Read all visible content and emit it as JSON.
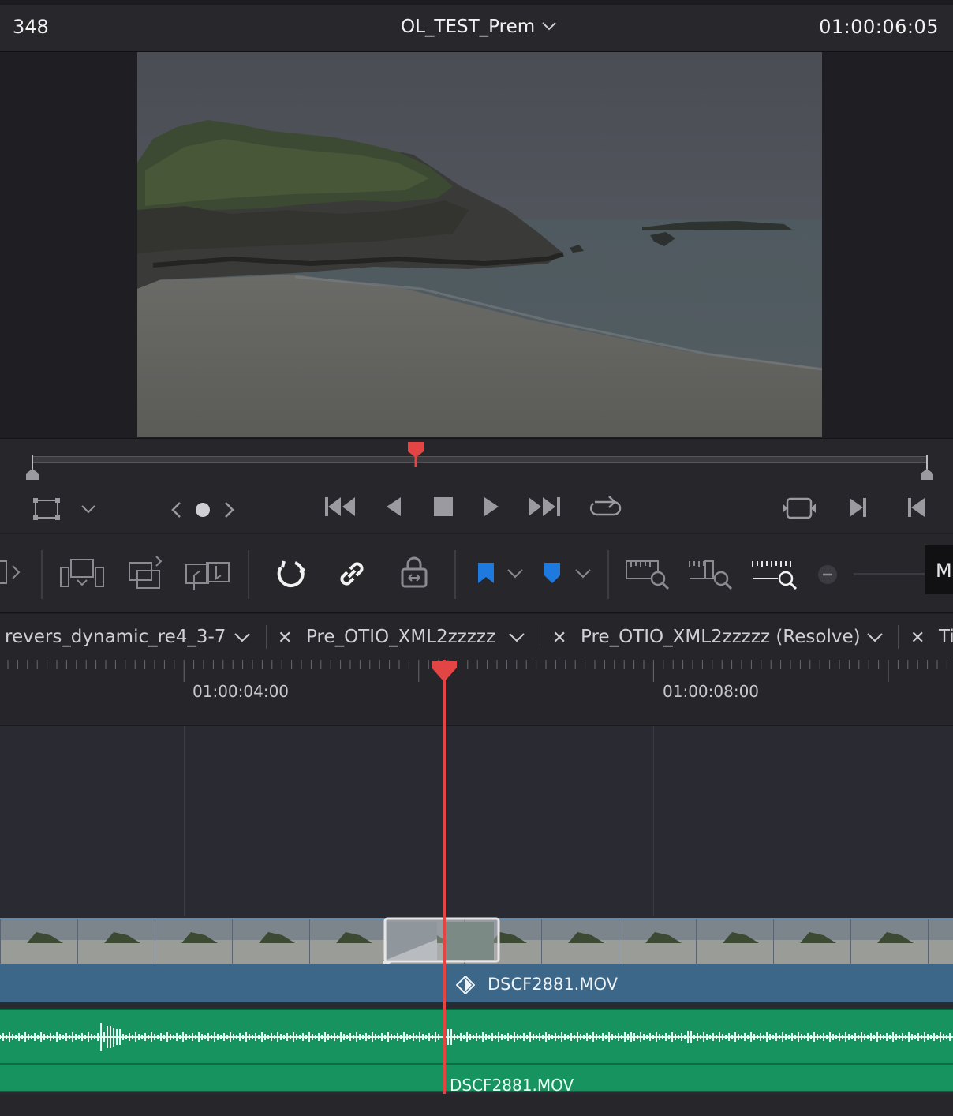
{
  "header": {
    "frame_count": "348",
    "timeline_title": "OL_TEST_Prem",
    "timecode": "01:00:06:05"
  },
  "tabs": [
    {
      "label": "revers_dynamic_re4_3-7"
    },
    {
      "label": "Pre_OTIO_XML2zzzzz"
    },
    {
      "label": "Pre_OTIO_XML2zzzzz (Resolve)"
    },
    {
      "label": "Ti"
    }
  ],
  "ruler": {
    "ticks": [
      "01:00:04:00",
      "01:00:08:00"
    ]
  },
  "tracks": {
    "video_clip_name": "DSCF2881.MOV",
    "audio_clip_name": "DSCF2881.MOV"
  },
  "toolbar": {
    "overflow_label": "M"
  },
  "colors": {
    "playhead": "#e34444",
    "video_clip": "#3c6788",
    "audio_clip": "#17935f",
    "flag_blue": "#1f7ae0"
  }
}
